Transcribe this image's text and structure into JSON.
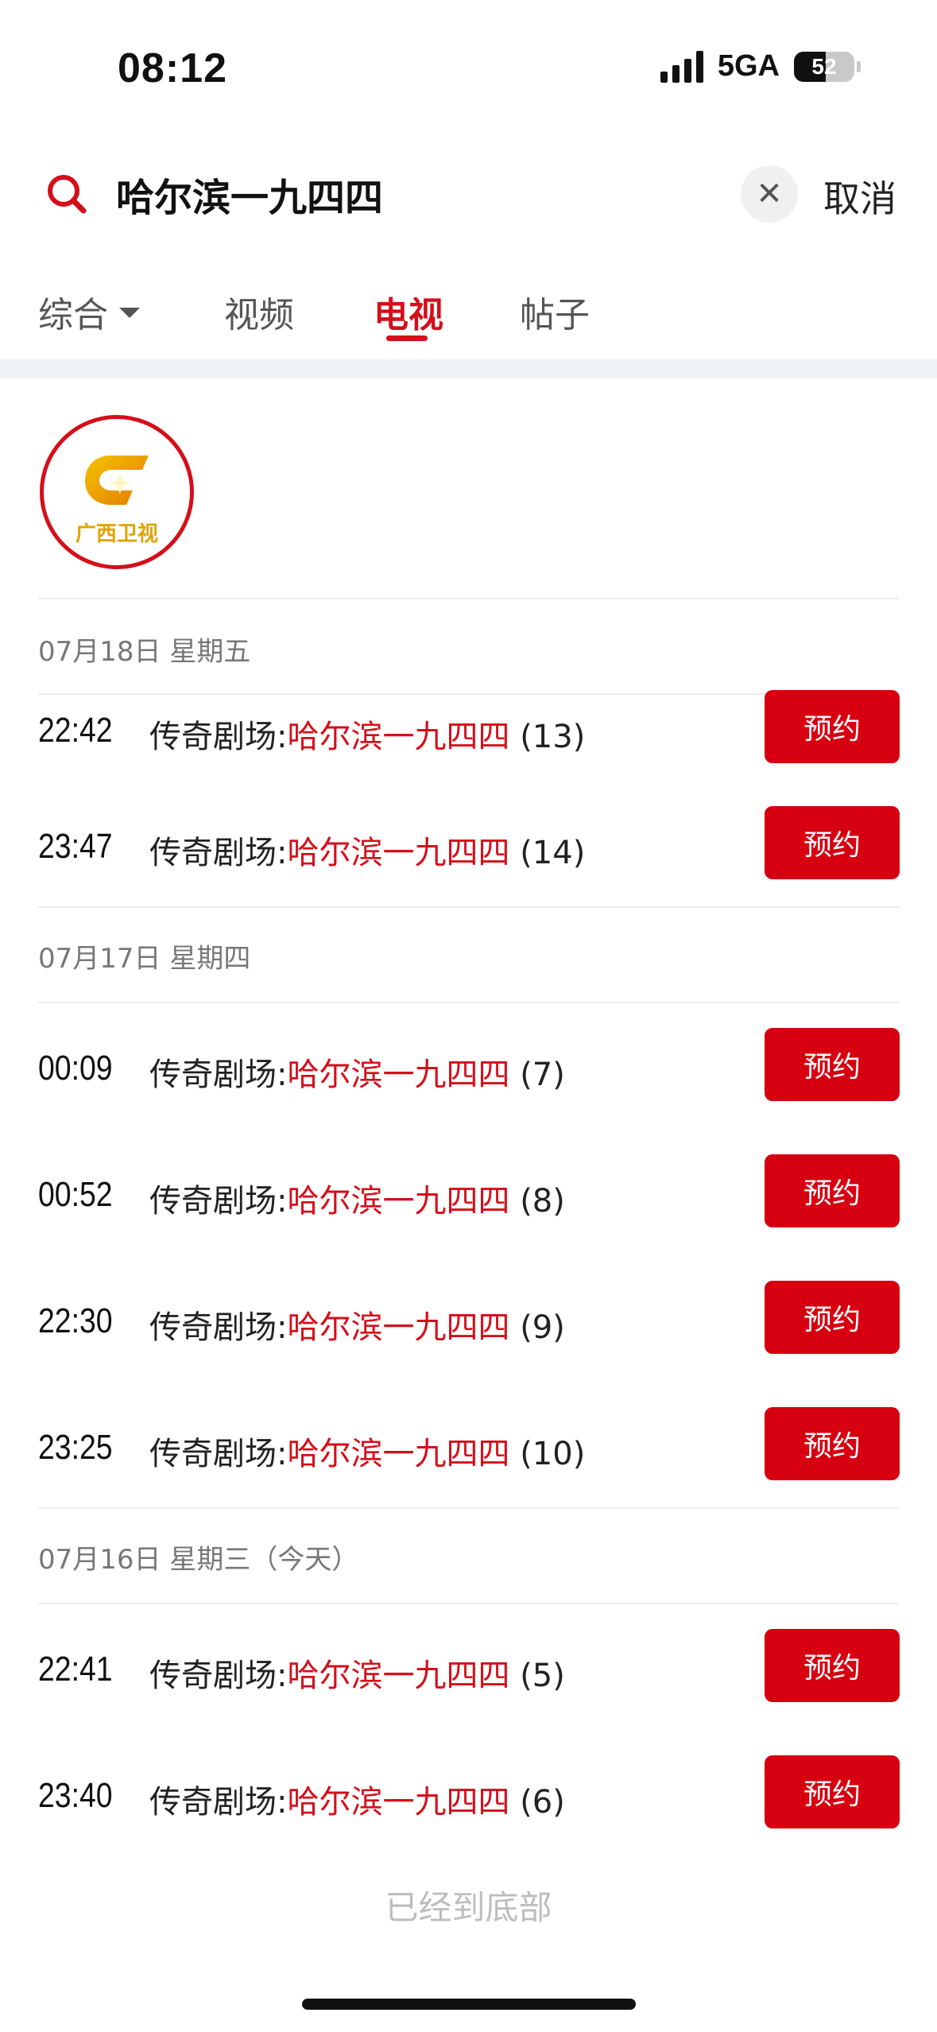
{
  "status_bar": {
    "time": "08:12",
    "network": "5GA",
    "battery_level": "52",
    "battery_fraction": 0.52
  },
  "search": {
    "query": "哈尔滨一九四四",
    "clear_symbol": "✕",
    "cancel_label": "取消"
  },
  "tabs": [
    {
      "label": "综合"
    },
    {
      "label": "视频"
    },
    {
      "label": "电视"
    },
    {
      "label": "帖子"
    }
  ],
  "active_tab": "电视",
  "channel": {
    "logo_text": "广西卫视"
  },
  "schedule": [
    {
      "date": "07月18日 星期五",
      "items": [
        {
          "time": "22:42",
          "prefix": "传奇剧场:",
          "highlight": "哈尔滨一九四四",
          "episode": "(13)",
          "button": "预约"
        },
        {
          "time": "23:47",
          "prefix": "传奇剧场:",
          "highlight": "哈尔滨一九四四",
          "episode": "(14)",
          "button": "预约"
        }
      ]
    },
    {
      "date": "07月17日 星期四",
      "items": [
        {
          "time": "00:09",
          "prefix": "传奇剧场:",
          "highlight": "哈尔滨一九四四",
          "episode": "(7)",
          "button": "预约"
        },
        {
          "time": "00:52",
          "prefix": "传奇剧场:",
          "highlight": "哈尔滨一九四四",
          "episode": "(8)",
          "button": "预约"
        },
        {
          "time": "22:30",
          "prefix": "传奇剧场:",
          "highlight": "哈尔滨一九四四",
          "episode": "(9)",
          "button": "预约"
        },
        {
          "time": "23:25",
          "prefix": "传奇剧场:",
          "highlight": "哈尔滨一九四四",
          "episode": "(10)",
          "button": "预约"
        }
      ]
    },
    {
      "date": "07月16日 星期三（今天）",
      "items": [
        {
          "time": "22:41",
          "prefix": "传奇剧场:",
          "highlight": "哈尔滨一九四四",
          "episode": "(5)",
          "button": "预约"
        },
        {
          "time": "23:40",
          "prefix": "传奇剧场:",
          "highlight": "哈尔滨一九四四",
          "episode": "(6)",
          "button": "预约"
        }
      ]
    }
  ],
  "footer": {
    "end_text": "已经到底部"
  },
  "colors": {
    "accent": "#d40f1a",
    "button": "#d70011",
    "logo_gold": "#e0a400"
  }
}
